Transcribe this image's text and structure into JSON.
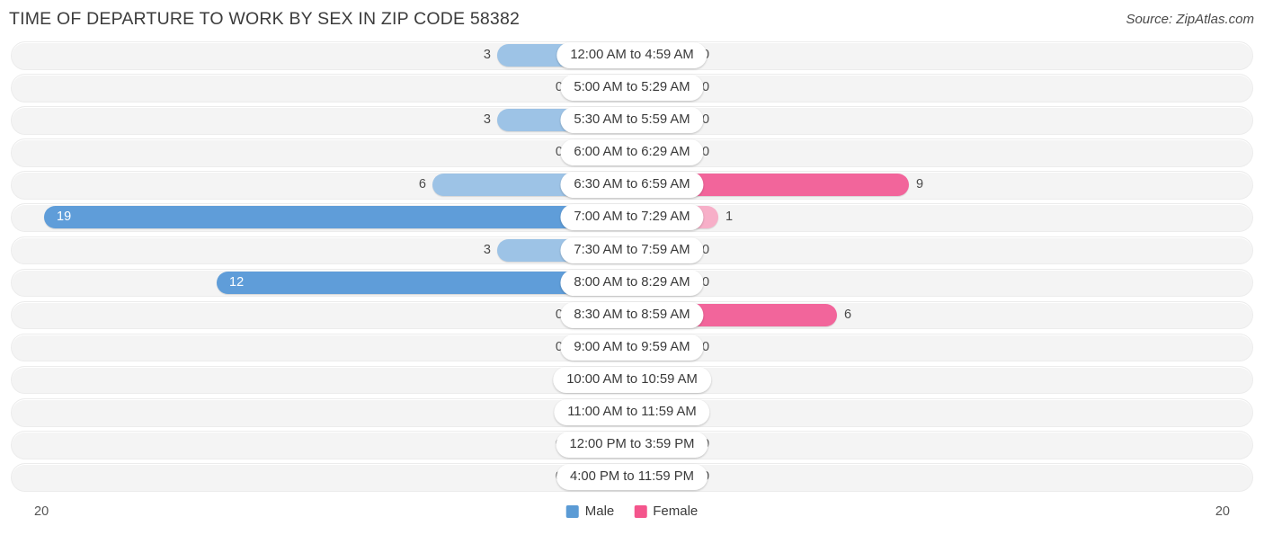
{
  "header": {
    "title": "TIME OF DEPARTURE TO WORK BY SEX IN ZIP CODE 58382",
    "source": "Source: ZipAtlas.com"
  },
  "legend": {
    "male_label": "Male",
    "female_label": "Female",
    "male_color": "#5b9bd5",
    "female_color": "#f4558c"
  },
  "axis": {
    "left_max": "20",
    "right_max": "20"
  },
  "chart_data": {
    "type": "bar",
    "title": "TIME OF DEPARTURE TO WORK BY SEX IN ZIP CODE 58382",
    "subtitle": "Source: ZipAtlas.com",
    "orientation": "horizontal-diverging",
    "xlabel": "",
    "ylabel": "",
    "xlim": [
      20,
      20
    ],
    "grid": false,
    "legend_position": "bottom-center",
    "categories": [
      "12:00 AM to 4:59 AM",
      "5:00 AM to 5:29 AM",
      "5:30 AM to 5:59 AM",
      "6:00 AM to 6:29 AM",
      "6:30 AM to 6:59 AM",
      "7:00 AM to 7:29 AM",
      "7:30 AM to 7:59 AM",
      "8:00 AM to 8:29 AM",
      "8:30 AM to 8:59 AM",
      "9:00 AM to 9:59 AM",
      "10:00 AM to 10:59 AM",
      "11:00 AM to 11:59 AM",
      "12:00 PM to 3:59 PM",
      "4:00 PM to 11:59 PM"
    ],
    "series": [
      {
        "name": "Male",
        "values": [
          3,
          0,
          3,
          0,
          6,
          19,
          3,
          12,
          0,
          0,
          0,
          0,
          0,
          0
        ]
      },
      {
        "name": "Female",
        "values": [
          0,
          0,
          0,
          0,
          9,
          1,
          0,
          0,
          6,
          0,
          0,
          0,
          0,
          0
        ]
      }
    ]
  },
  "rows": [
    {
      "label": "12:00 AM to 4:59 AM",
      "male": "3",
      "female": "0",
      "male_w": 150,
      "female_w": 70,
      "male_strong": false,
      "female_strong": false,
      "male_inside": false
    },
    {
      "label": "5:00 AM to 5:29 AM",
      "male": "0",
      "female": "0",
      "male_w": 70,
      "female_w": 70,
      "male_strong": false,
      "female_strong": false,
      "male_inside": false
    },
    {
      "label": "5:30 AM to 5:59 AM",
      "male": "3",
      "female": "0",
      "male_w": 150,
      "female_w": 70,
      "male_strong": false,
      "female_strong": false,
      "male_inside": false
    },
    {
      "label": "6:00 AM to 6:29 AM",
      "male": "0",
      "female": "0",
      "male_w": 70,
      "female_w": 70,
      "male_strong": false,
      "female_strong": false,
      "male_inside": false
    },
    {
      "label": "6:30 AM to 6:59 AM",
      "male": "6",
      "female": "9",
      "male_w": 222,
      "female_w": 308,
      "male_strong": false,
      "female_strong": true,
      "male_inside": false
    },
    {
      "label": "7:00 AM to 7:29 AM",
      "male": "19",
      "female": "1",
      "male_w": 654,
      "female_w": 96,
      "male_strong": true,
      "female_strong": false,
      "male_inside": true
    },
    {
      "label": "7:30 AM to 7:59 AM",
      "male": "3",
      "female": "0",
      "male_w": 150,
      "female_w": 70,
      "male_strong": false,
      "female_strong": false,
      "male_inside": false
    },
    {
      "label": "8:00 AM to 8:29 AM",
      "male": "12",
      "female": "0",
      "male_w": 462,
      "female_w": 70,
      "male_strong": true,
      "female_strong": false,
      "male_inside": true
    },
    {
      "label": "8:30 AM to 8:59 AM",
      "male": "0",
      "female": "6",
      "male_w": 70,
      "female_w": 228,
      "male_strong": false,
      "female_strong": true,
      "male_inside": false
    },
    {
      "label": "9:00 AM to 9:59 AM",
      "male": "0",
      "female": "0",
      "male_w": 70,
      "female_w": 70,
      "male_strong": false,
      "female_strong": false,
      "male_inside": false
    },
    {
      "label": "10:00 AM to 10:59 AM",
      "male": "0",
      "female": "0",
      "male_w": 70,
      "female_w": 70,
      "male_strong": false,
      "female_strong": false,
      "male_inside": false
    },
    {
      "label": "11:00 AM to 11:59 AM",
      "male": "0",
      "female": "0",
      "male_w": 70,
      "female_w": 70,
      "male_strong": false,
      "female_strong": false,
      "male_inside": false
    },
    {
      "label": "12:00 PM to 3:59 PM",
      "male": "0",
      "female": "0",
      "male_w": 70,
      "female_w": 70,
      "male_strong": false,
      "female_strong": false,
      "male_inside": false
    },
    {
      "label": "4:00 PM to 11:59 PM",
      "male": "0",
      "female": "0",
      "male_w": 70,
      "female_w": 70,
      "male_strong": false,
      "female_strong": false,
      "male_inside": false
    }
  ]
}
